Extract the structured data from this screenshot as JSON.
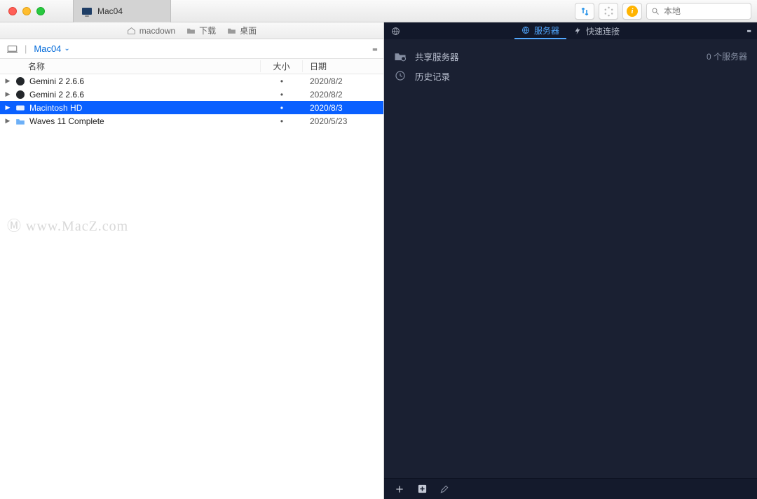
{
  "tab_title": "Mac04",
  "search_placeholder": "本地",
  "path_items": [
    "macdown",
    "下载",
    "桌面"
  ],
  "location_name": "Mac04",
  "columns": {
    "name": "名称",
    "size": "大小",
    "date": "日期"
  },
  "files": [
    {
      "name": "Gemini 2 2.6.6",
      "size": "•",
      "date": "2020/8/2",
      "icon": "gemini",
      "selected": false
    },
    {
      "name": "Gemini 2 2.6.6",
      "size": "•",
      "date": "2020/8/2",
      "icon": "gemini",
      "selected": false
    },
    {
      "name": "Macintosh HD",
      "size": "•",
      "date": "2020/8/3",
      "icon": "hdd",
      "selected": true
    },
    {
      "name": "Waves 11 Complete",
      "size": "•",
      "date": "2020/5/23",
      "icon": "folder",
      "selected": false
    }
  ],
  "watermark": "Ⓜ www.MacZ.com",
  "right_tabs": {
    "server": "服务器",
    "quick": "快速连接"
  },
  "right_items": [
    {
      "label": "共享服务器",
      "count": "0 个服务器",
      "icon": "folder-server"
    },
    {
      "label": "历史记录",
      "count": "",
      "icon": "history"
    }
  ]
}
